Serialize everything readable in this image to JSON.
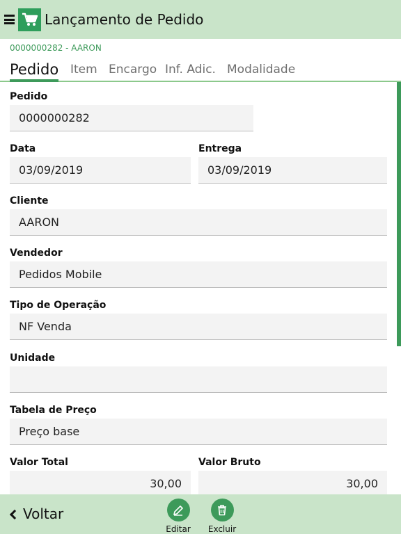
{
  "header": {
    "title": "Lançamento de Pedido",
    "menu_icon": "menu-icon",
    "logo_icon": "shopping-cart-icon",
    "accent_color": "#2e9e5b",
    "bar_color": "#c9e4c9"
  },
  "subtitle": "0000000282 - AARON",
  "tabs": [
    {
      "label": "Pedido",
      "active": true
    },
    {
      "label": "Item"
    },
    {
      "label": "Encargo"
    },
    {
      "label": "Inf. Adic."
    },
    {
      "label": "Modalidade"
    }
  ],
  "form": {
    "pedido": {
      "label": "Pedido",
      "value": "0000000282"
    },
    "data": {
      "label": "Data",
      "value": "03/09/2019"
    },
    "entrega": {
      "label": "Entrega",
      "value": "03/09/2019"
    },
    "cliente": {
      "label": "Cliente",
      "value": "AARON"
    },
    "vendedor": {
      "label": "Vendedor",
      "value": "Pedidos Mobile"
    },
    "tipo_operacao": {
      "label": "Tipo de Operação",
      "value": "NF Venda"
    },
    "unidade": {
      "label": "Unidade",
      "value": ""
    },
    "tabela_preco": {
      "label": "Tabela de Preço",
      "value": "Preço base"
    },
    "valor_total": {
      "label": "Valor Total",
      "value": "30,00"
    },
    "valor_bruto": {
      "label": "Valor Bruto",
      "value": "30,00"
    }
  },
  "footer": {
    "back_label": "Voltar",
    "edit_label": "Editar",
    "delete_label": "Excluir",
    "edit_icon": "pencil-icon",
    "delete_icon": "trash-icon"
  }
}
